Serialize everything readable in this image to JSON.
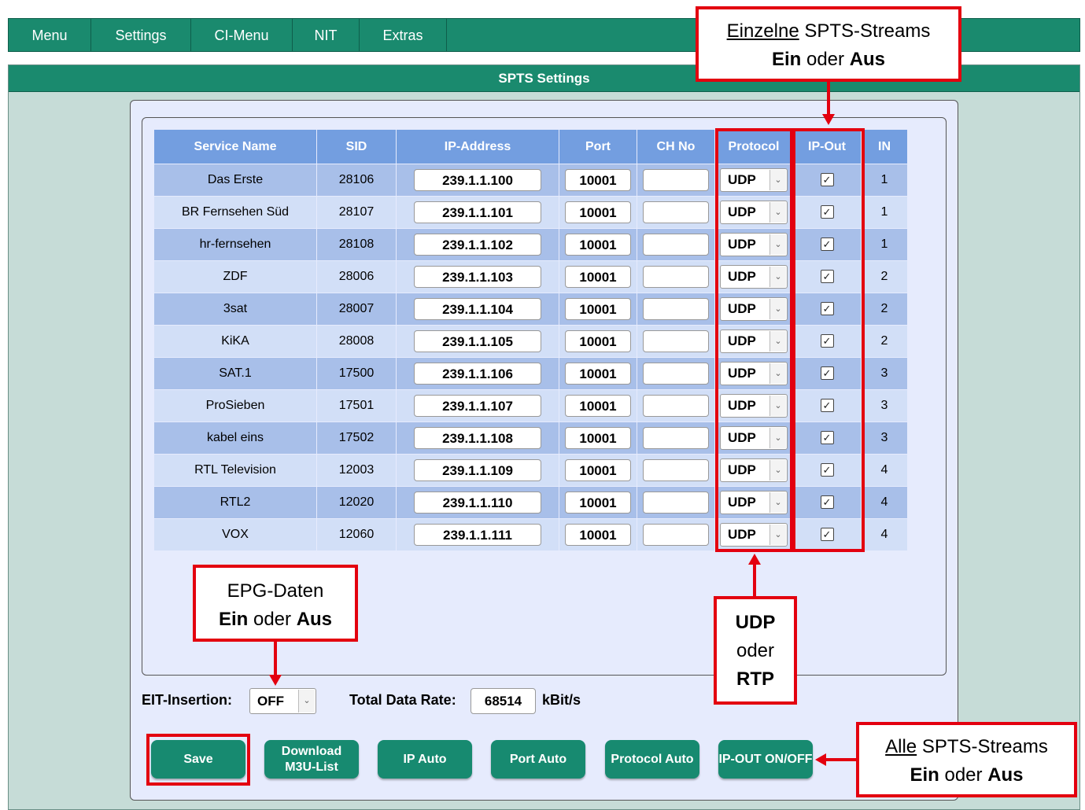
{
  "nav": {
    "items": [
      "Menu",
      "Settings",
      "CI-Menu",
      "NIT",
      "Extras"
    ]
  },
  "panel": {
    "title": "SPTS Settings"
  },
  "table": {
    "headers": [
      "Service Name",
      "SID",
      "IP-Address",
      "Port",
      "CH No",
      "Protocol",
      "IP-Out",
      "IN"
    ],
    "rows": [
      {
        "name": "Das Erste",
        "sid": "28106",
        "ip": "239.1.1.100",
        "port": "10001",
        "ch": "",
        "protocol": "UDP",
        "ipout": true,
        "in": "1"
      },
      {
        "name": "BR Fernsehen Süd",
        "sid": "28107",
        "ip": "239.1.1.101",
        "port": "10001",
        "ch": "",
        "protocol": "UDP",
        "ipout": true,
        "in": "1"
      },
      {
        "name": "hr-fernsehen",
        "sid": "28108",
        "ip": "239.1.1.102",
        "port": "10001",
        "ch": "",
        "protocol": "UDP",
        "ipout": true,
        "in": "1"
      },
      {
        "name": "ZDF",
        "sid": "28006",
        "ip": "239.1.1.103",
        "port": "10001",
        "ch": "",
        "protocol": "UDP",
        "ipout": true,
        "in": "2"
      },
      {
        "name": "3sat",
        "sid": "28007",
        "ip": "239.1.1.104",
        "port": "10001",
        "ch": "",
        "protocol": "UDP",
        "ipout": true,
        "in": "2"
      },
      {
        "name": "KiKA",
        "sid": "28008",
        "ip": "239.1.1.105",
        "port": "10001",
        "ch": "",
        "protocol": "UDP",
        "ipout": true,
        "in": "2"
      },
      {
        "name": "SAT.1",
        "sid": "17500",
        "ip": "239.1.1.106",
        "port": "10001",
        "ch": "",
        "protocol": "UDP",
        "ipout": true,
        "in": "3"
      },
      {
        "name": "ProSieben",
        "sid": "17501",
        "ip": "239.1.1.107",
        "port": "10001",
        "ch": "",
        "protocol": "UDP",
        "ipout": true,
        "in": "3"
      },
      {
        "name": "kabel eins",
        "sid": "17502",
        "ip": "239.1.1.108",
        "port": "10001",
        "ch": "",
        "protocol": "UDP",
        "ipout": true,
        "in": "3"
      },
      {
        "name": "RTL Television",
        "sid": "12003",
        "ip": "239.1.1.109",
        "port": "10001",
        "ch": "",
        "protocol": "UDP",
        "ipout": true,
        "in": "4"
      },
      {
        "name": "RTL2",
        "sid": "12020",
        "ip": "239.1.1.110",
        "port": "10001",
        "ch": "",
        "protocol": "UDP",
        "ipout": true,
        "in": "4"
      },
      {
        "name": "VOX",
        "sid": "12060",
        "ip": "239.1.1.111",
        "port": "10001",
        "ch": "",
        "protocol": "UDP",
        "ipout": true,
        "in": "4"
      }
    ]
  },
  "controls": {
    "eit_label": "EIT-Insertion:",
    "eit_value": "OFF",
    "rate_label": "Total Data Rate:",
    "rate_value": "68514",
    "rate_unit": "kBit/s"
  },
  "buttons": {
    "save": "Save",
    "download_line1": "Download",
    "download_line2": "M3U-List",
    "ip_auto": "IP Auto",
    "port_auto": "Port Auto",
    "protocol_auto": "Protocol Auto",
    "ipout_onoff": "IP-OUT ON/OFF"
  },
  "annotations": {
    "single": {
      "line1_u": "Einzelne",
      "line1_rest": " SPTS-Streams",
      "b1": "Ein",
      "mid": " oder ",
      "b2": "Aus"
    },
    "epg": {
      "line1": "EPG-Daten",
      "b1": "Ein",
      "mid": " oder ",
      "b2": "Aus"
    },
    "udp": {
      "l1": "UDP",
      "l2": "oder",
      "l3": "RTP"
    },
    "all": {
      "line1_u": "Alle",
      "line1_rest": " SPTS-Streams",
      "b1": "Ein",
      "mid": " oder ",
      "b2": "Aus"
    }
  },
  "colors": {
    "header_green": "#1a8a6e",
    "table_header": "#739ee0",
    "row_dark": "#a8bfe9",
    "row_light": "#d2dff7",
    "annotation_red": "#e3000f"
  }
}
